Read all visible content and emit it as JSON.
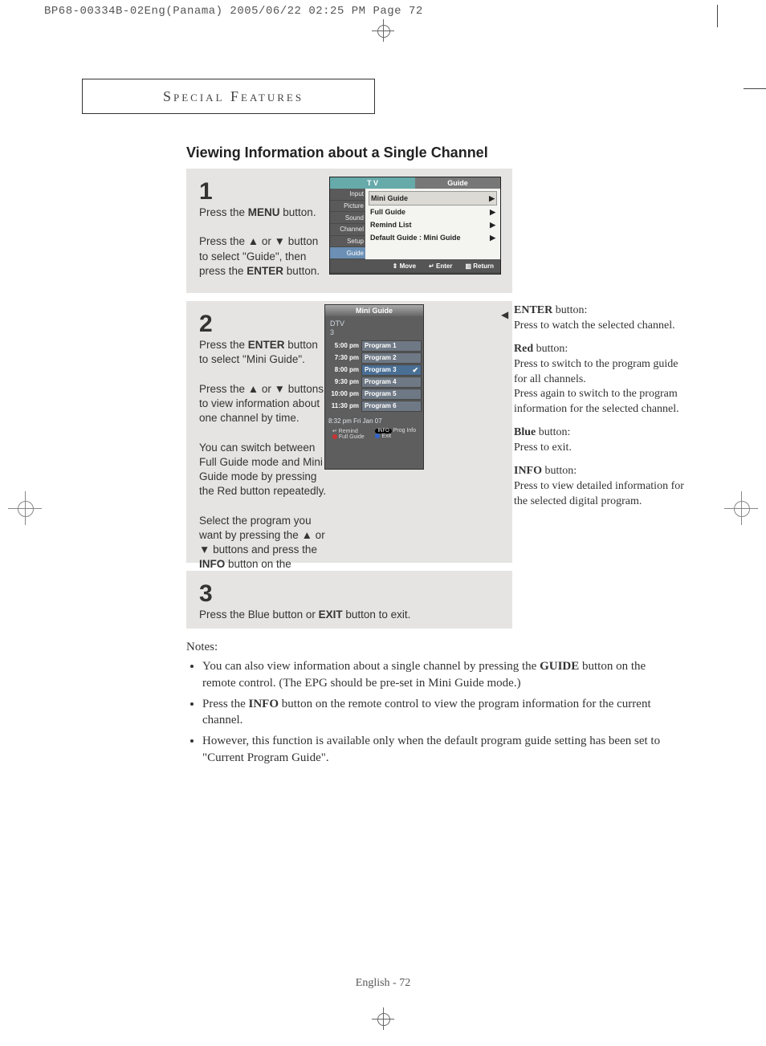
{
  "print_header": "BP68-00334B-02Eng(Panama)  2005/06/22  02:25 PM  Page 72",
  "section_title": "Special Features",
  "page_title": "Viewing Information about a Single Channel",
  "steps": {
    "s1": {
      "num": "1",
      "p1a": "Press the ",
      "p1b": "MENU",
      "p1c": " button.",
      "p2": "Press the ▲ or ▼ button to select \"Guide\", then press the ",
      "p2b": "ENTER",
      "p2c": " button."
    },
    "s2": {
      "num": "2",
      "p1a": "Press the ",
      "p1b": "ENTER",
      "p1c": " button to select \"Mini  Guide\".",
      "p2": "Press the ▲ or ▼ buttons to view information about one channel by time.",
      "p3": "You can switch between Full Guide mode and Mini Guide mode by pressing the Red button repeatedly.",
      "p4a": "Select the program you want by pressing the ▲ or ▼ buttons and press the ",
      "p4b": "INFO",
      "p4c": " button on the remote control."
    },
    "s3": {
      "num": "3",
      "p1a": "Press the Blue button or ",
      "p1b": "EXIT",
      "p1c": " button to exit."
    }
  },
  "osd1": {
    "tabs": [
      "T V",
      "Guide"
    ],
    "side": [
      "Input",
      "Picture",
      "Sound",
      "Channel",
      "Setup",
      "Guide"
    ],
    "rows": [
      {
        "label": "Mini Guide",
        "val": "",
        "arrow": "▶"
      },
      {
        "label": "Full Guide",
        "val": "",
        "arrow": "▶"
      },
      {
        "label": "Remind List",
        "val": "",
        "arrow": "▶"
      },
      {
        "label": "Default Guide",
        "val": ":   Mini Guide",
        "arrow": "▶"
      }
    ],
    "footer": [
      "Move",
      "Enter",
      "Return"
    ]
  },
  "osd2": {
    "title": "Mini Guide",
    "channel": "DTV",
    "channel_num": "3",
    "rows": [
      {
        "time": "5:00 pm",
        "prog": "Program 1",
        "sel": false,
        "chk": false
      },
      {
        "time": "7:30 pm",
        "prog": "Program 2",
        "sel": false,
        "chk": false
      },
      {
        "time": "8:00 pm",
        "prog": "Program 3",
        "sel": true,
        "chk": true
      },
      {
        "time": "9:30 pm",
        "prog": "Program 4",
        "sel": false,
        "chk": false
      },
      {
        "time": "10:00 pm",
        "prog": "Program 5",
        "sel": false,
        "chk": false
      },
      {
        "time": "11:30 pm",
        "prog": "Program 6",
        "sel": false,
        "chk": false
      }
    ],
    "timestamp": "8:32 pm Fri Jan 07",
    "footer": [
      {
        "color": "#c33",
        "t1": "Remind",
        "t2": "Full Guide"
      },
      {
        "color": "#000",
        "t1": "INFO",
        "t2": "Prog Info"
      },
      {
        "color": "#36c",
        "t1": "",
        "t2": "Exit"
      }
    ]
  },
  "side_notes": {
    "l1b": "ENTER",
    "l1": " button:",
    "l1t": "Press to watch the selected channel.",
    "l2b": "Red",
    "l2": " button:",
    "l2t": "Press to switch to the program guide for all channels.",
    "l2t2": "Press again to switch to the program information for the selected channel.",
    "l3b": "Blue",
    "l3": " button:",
    "l3t": "Press to exit.",
    "l4b": "INFO",
    "l4": " button:",
    "l4t": "Press to view detailed information for the selected digital program."
  },
  "notes": {
    "head": "Notes:",
    "n1a": "You can also view information about a single channel by pressing the ",
    "n1b": "GUIDE",
    "n1c": " button on the remote control. (The EPG should be pre-set in Mini Guide mode.)",
    "n2a": "Press the ",
    "n2b": "INFO",
    "n2c": " button on the remote control to view the program information for the current channel.",
    "n3": "However, this function is available only when the default program guide setting has been set to \"Current Program Guide\"."
  },
  "footer": "English - 72"
}
